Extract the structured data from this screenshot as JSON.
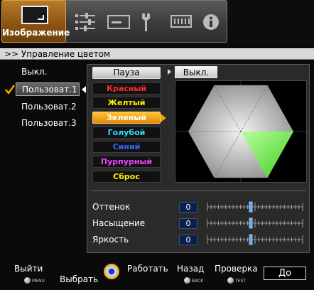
{
  "toolbar": {
    "tabs": [
      {
        "label": "Изображение",
        "icon": "picture-icon",
        "active": true
      },
      {
        "icon": "sliders-icon"
      },
      {
        "icon": "screen-icon"
      },
      {
        "icon": "wrench-icon"
      },
      {
        "icon": "chip-icon"
      },
      {
        "icon": "info-icon"
      }
    ]
  },
  "header": {
    "title": ">> Управление цветом"
  },
  "modes": {
    "items": [
      "Выкл.",
      "Пользоват.1",
      "Пользоват.2",
      "Пользоват.3"
    ],
    "selected": "Пользоват.1"
  },
  "color_controls": {
    "pause_label": "Пауза",
    "pause_value": "Выкл.",
    "buttons": [
      {
        "label": "Красный",
        "color": "#ff2b2b"
      },
      {
        "label": "Желтый",
        "color": "#ffee00"
      },
      {
        "label": "Зеленый",
        "color": "#ffffff",
        "selected": true
      },
      {
        "label": "Голубой",
        "color": "#33ddff"
      },
      {
        "label": "Синий",
        "color": "#3a66ff"
      },
      {
        "label": "Пурпурный",
        "color": "#ee44ff"
      },
      {
        "label": "Сброс",
        "color": "#ffee00"
      }
    ]
  },
  "sliders": [
    {
      "label": "Оттенок",
      "value": "0"
    },
    {
      "label": "Насыщение",
      "value": "0"
    },
    {
      "label": "Яркость",
      "value": "0"
    }
  ],
  "footer": {
    "exit": "Выйти",
    "exit_key": "MENU",
    "select": "Выбрать",
    "operate": "Работать",
    "back": "Назад",
    "back_key": "BACK",
    "check": "Проверка",
    "check_key": "TEST",
    "ok": "До"
  },
  "colors": {
    "accent": "#f2a400",
    "highlight_green": "#6dff3a"
  }
}
